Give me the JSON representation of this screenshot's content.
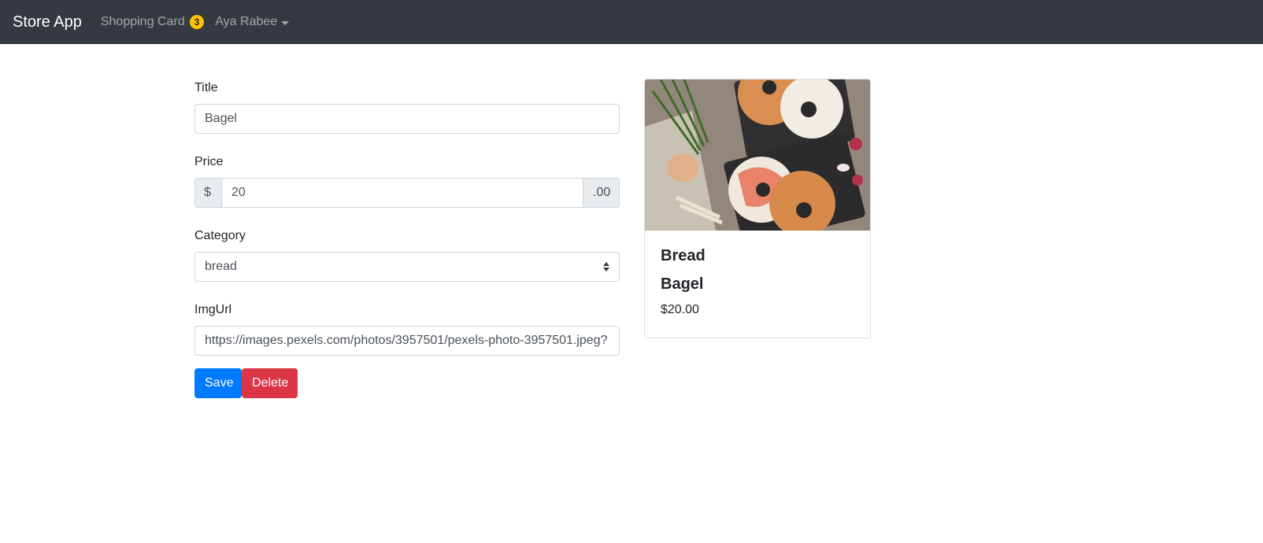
{
  "navbar": {
    "brand": "Store App",
    "cart_label": "Shopping Card",
    "cart_count": "3",
    "user_name": "Aya Rabee"
  },
  "form": {
    "title_label": "Title",
    "title_value": "Bagel",
    "price_label": "Price",
    "price_prefix": "$",
    "price_value": "20",
    "price_suffix": ".00",
    "category_label": "Category",
    "category_value": "bread",
    "imgurl_label": "ImgUrl",
    "imgurl_value": "https://images.pexels.com/photos/3957501/pexels-photo-3957501.jpeg?",
    "save_label": "Save",
    "delete_label": "Delete"
  },
  "card": {
    "category": "Bread",
    "title": "Bagel",
    "price": "$20.00"
  },
  "colors": {
    "navbar_bg": "#343a40",
    "badge": "#ffc107",
    "primary": "#007bff",
    "danger": "#dc3545"
  }
}
